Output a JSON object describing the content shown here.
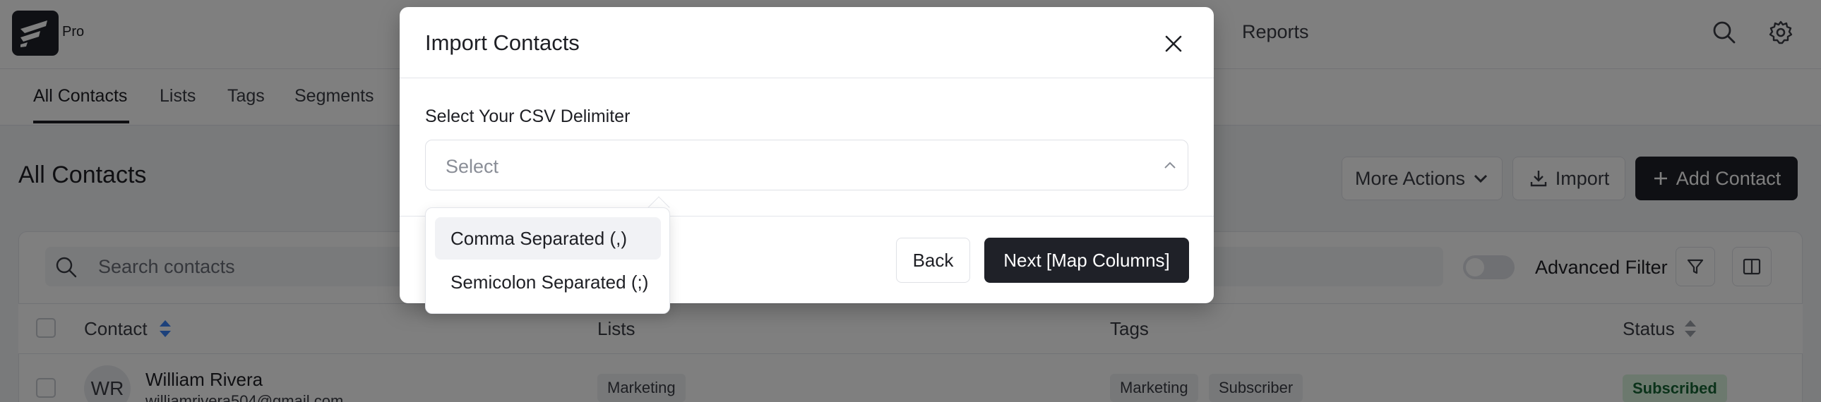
{
  "topbar": {
    "brand_suffix": "Pro",
    "nav_reports": "Reports"
  },
  "subnav": {
    "items": [
      "All Contacts",
      "Lists",
      "Tags",
      "Segments"
    ],
    "active": "All Contacts"
  },
  "page": {
    "title": "All Contacts",
    "more_actions_label": "More Actions",
    "import_label": "Import",
    "add_contact_label": "Add Contact"
  },
  "filters": {
    "search_placeholder": "Search contacts",
    "advanced_filter_label": "Advanced Filter",
    "advanced_filter_on": false
  },
  "table": {
    "columns": [
      "Contact",
      "Lists",
      "Tags",
      "Status"
    ],
    "rows": [
      {
        "initials": "WR",
        "name": "William Rivera",
        "email": "williamrivera504@gmail.com",
        "lists": [
          "Marketing"
        ],
        "tags": [
          "Marketing",
          "Subscriber"
        ],
        "status": "Subscribed"
      }
    ]
  },
  "modal": {
    "title": "Import Contacts",
    "field_label": "Select Your CSV Delimiter",
    "select_placeholder": "Select",
    "back_label": "Back",
    "next_label": "Next [Map Columns]"
  },
  "dropdown": {
    "options": [
      "Comma Separated (,)",
      "Semicolon Separated (;)"
    ],
    "highlighted_index": 0
  },
  "colors": {
    "dark": "#1f2128",
    "status_green_bg": "#d9f2dd",
    "status_green_text": "#166534",
    "sort_icon": "#3b82f6"
  }
}
